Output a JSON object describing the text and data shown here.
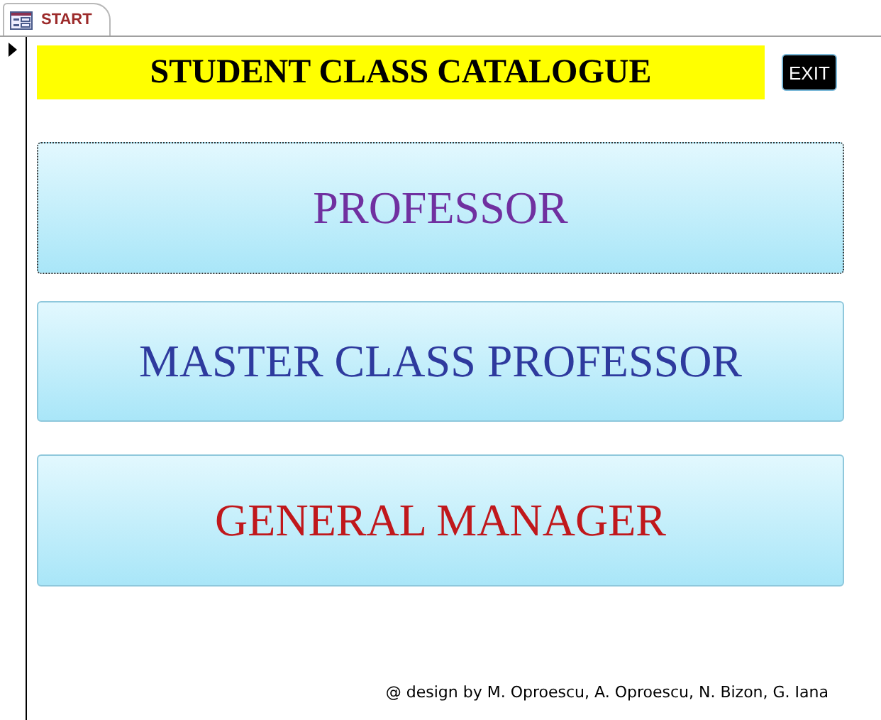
{
  "tab": {
    "label": "START",
    "selected": true
  },
  "title": "STUDENT CLASS CATALOGUE",
  "exit_button": "EXIT",
  "buttons": [
    {
      "label": "PROFESSOR",
      "color": "#7030a0",
      "focused": true
    },
    {
      "label": "MASTER CLASS PROFESSOR",
      "color": "#2e3a9e",
      "focused": false
    },
    {
      "label": "GENERAL MANAGER",
      "color": "#c0181c",
      "focused": false
    }
  ],
  "footer": "@ design by M. Oproescu, A. Oproescu, N. Bizon, G. Iana"
}
